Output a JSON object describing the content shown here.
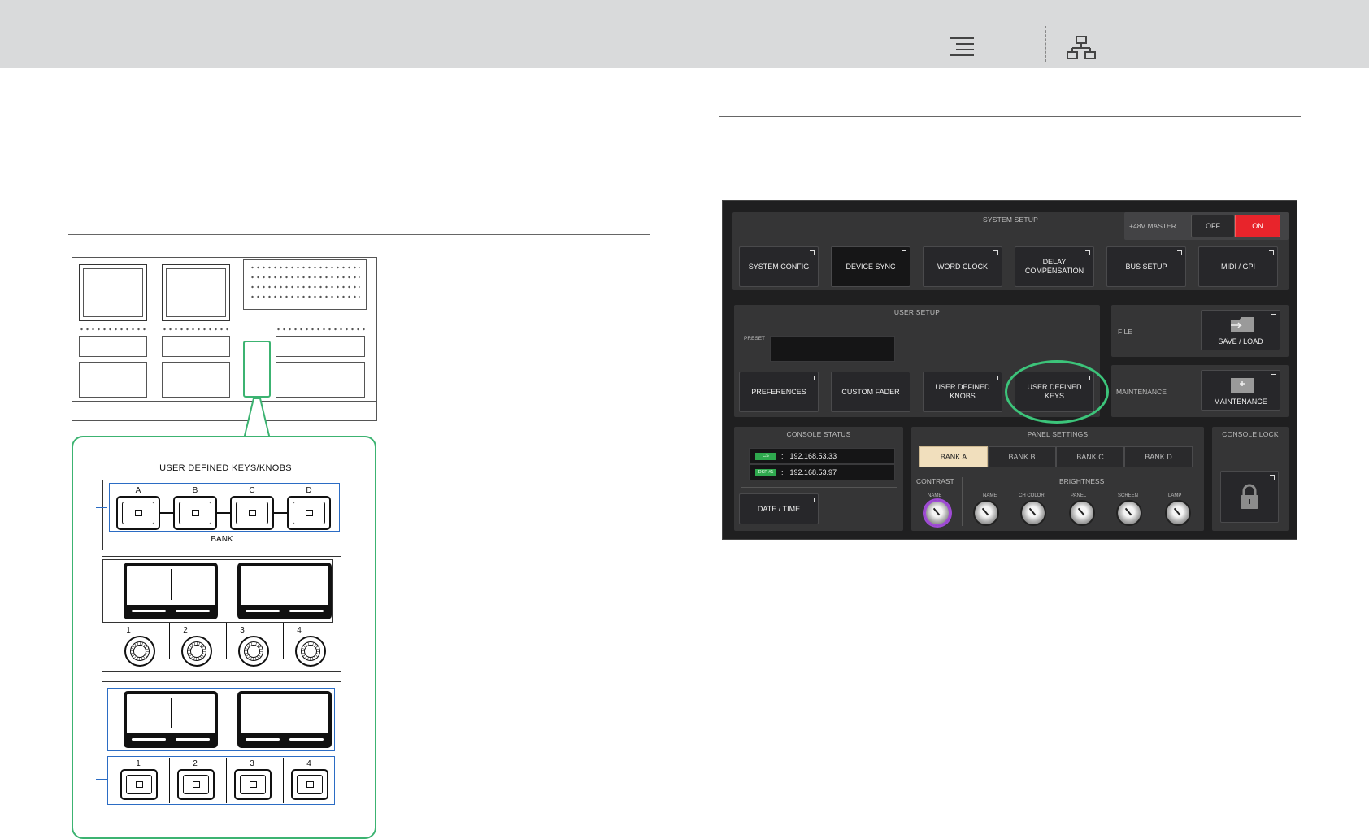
{
  "header": {
    "toc_icon": "toc-icon",
    "sitemap_icon": "sitemap-icon"
  },
  "illustration": {
    "title": "USER DEFINED KEYS/KNOBS",
    "bank_keys": [
      "A",
      "B",
      "C",
      "D"
    ],
    "bank_label": "BANK",
    "knob_numbers": [
      "1",
      "2",
      "3",
      "4"
    ],
    "key_numbers": [
      "1",
      "2",
      "3",
      "4"
    ]
  },
  "ui": {
    "system_setup": {
      "title": "SYSTEM SETUP",
      "phantom_label": "+48V MASTER",
      "off_label": "OFF",
      "on_label": "ON",
      "buttons": [
        "SYSTEM CONFIG",
        "DEVICE SYNC",
        "WORD CLOCK",
        "DELAY\nCOMPENSATION",
        "BUS SETUP",
        "MIDI / GPI"
      ]
    },
    "user_setup": {
      "title": "USER SETUP",
      "preset_label": "PRESET",
      "buttons": [
        "PREFERENCES",
        "CUSTOM FADER",
        "USER DEFINED\nKNOBS",
        "USER DEFINED\nKEYS"
      ]
    },
    "file": {
      "label": "FILE",
      "button": "SAVE / LOAD"
    },
    "maintenance": {
      "label": "MAINTENANCE",
      "button": "MAINTENANCE"
    },
    "console_status": {
      "title": "CONSOLE STATUS",
      "rows": [
        {
          "tag": "CS",
          "value": "192.168.53.33"
        },
        {
          "tag": "DSP #1",
          "value": "192.168.53.97"
        }
      ],
      "separator": ":",
      "date_time": "DATE / TIME"
    },
    "panel_settings": {
      "title": "PANEL SETTINGS",
      "banks": [
        "BANK A",
        "BANK B",
        "BANK C",
        "BANK D"
      ],
      "active_bank": "BANK A",
      "contrast_label": "CONTRAST",
      "brightness_label": "BRIGHTNESS",
      "contrast_knobs": [
        "NAME"
      ],
      "brightness_knobs": [
        "NAME",
        "CH COLOR",
        "PANEL",
        "SCREEN",
        "LAMP"
      ]
    },
    "console_lock": {
      "title": "CONSOLE LOCK",
      "icon": "lock-icon"
    }
  },
  "colors": {
    "highlight_green": "#3cc47a",
    "callout_blue": "#2b6cc4",
    "on_red": "#e8242b",
    "active_bank": "#f1dfbd"
  }
}
